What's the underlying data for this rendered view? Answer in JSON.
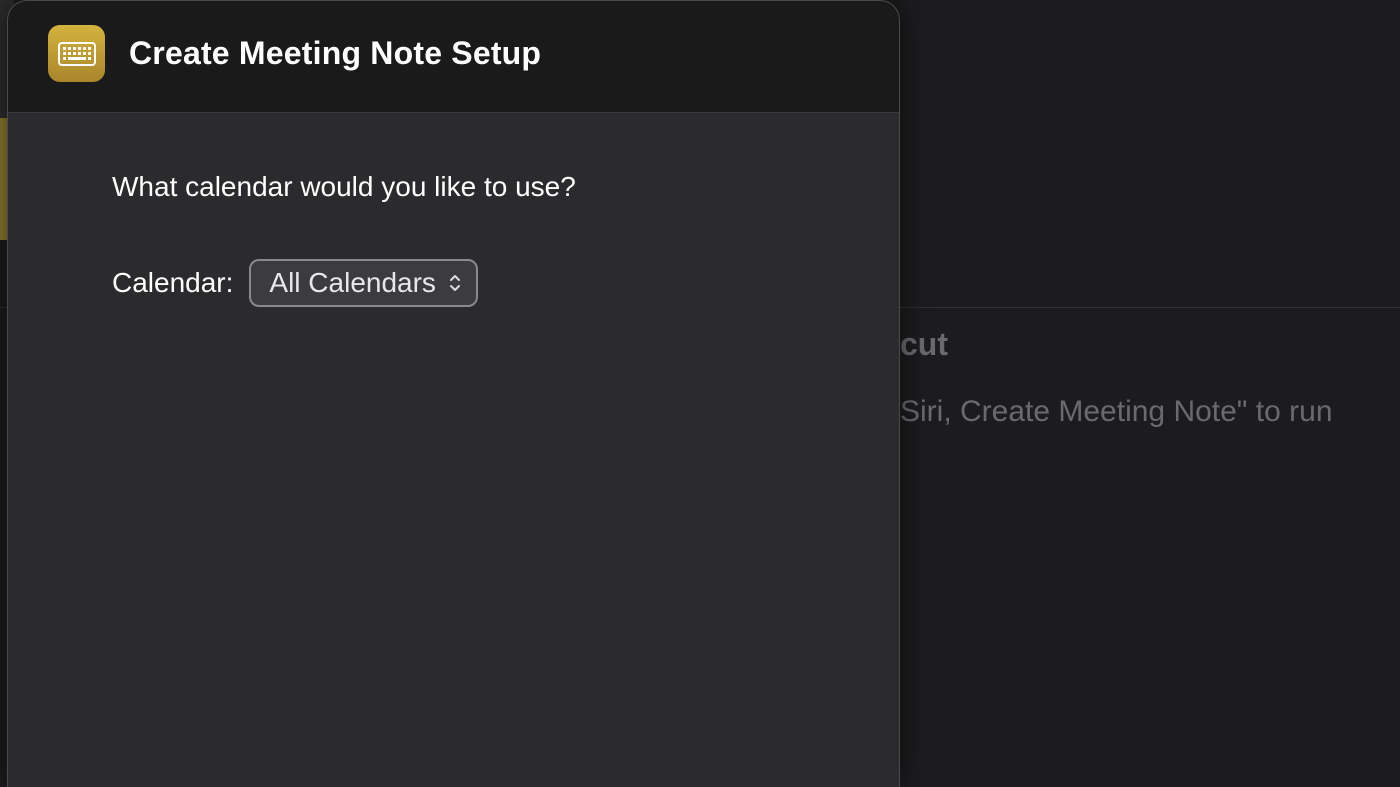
{
  "modal": {
    "title": "Create Meeting Note Setup",
    "icon": "keyboard-icon",
    "prompt": "What calendar would you like to use?",
    "field": {
      "label": "Calendar:",
      "selected": "All Calendars"
    }
  },
  "background": {
    "sidepanel_title_fragment": "cut",
    "sidepanel_text_fragment": "Siri, Create Meeting Note\" to run"
  }
}
